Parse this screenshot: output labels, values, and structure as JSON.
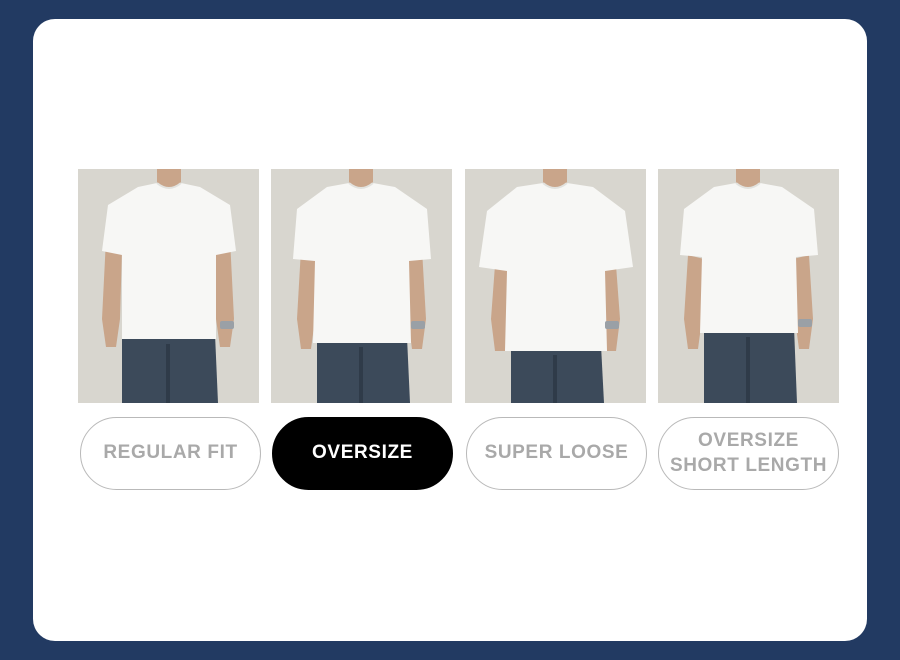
{
  "options": [
    {
      "label": "REGULAR FIT",
      "selected": false
    },
    {
      "label": "OVERSIZE",
      "selected": true
    },
    {
      "label": "SUPER LOOSE",
      "selected": false
    },
    {
      "label_lines": [
        "OVERSIZE",
        "SHORT LENGTH"
      ],
      "selected": false
    }
  ],
  "colors": {
    "frame": "#223a62",
    "card": "#ffffff",
    "selected_bg": "#000000",
    "unselected_text": "#a9a9a9",
    "photo_bg": "#d6d4cd",
    "shirt": "#f7f7f5",
    "jeans": "#3c4a5a"
  }
}
